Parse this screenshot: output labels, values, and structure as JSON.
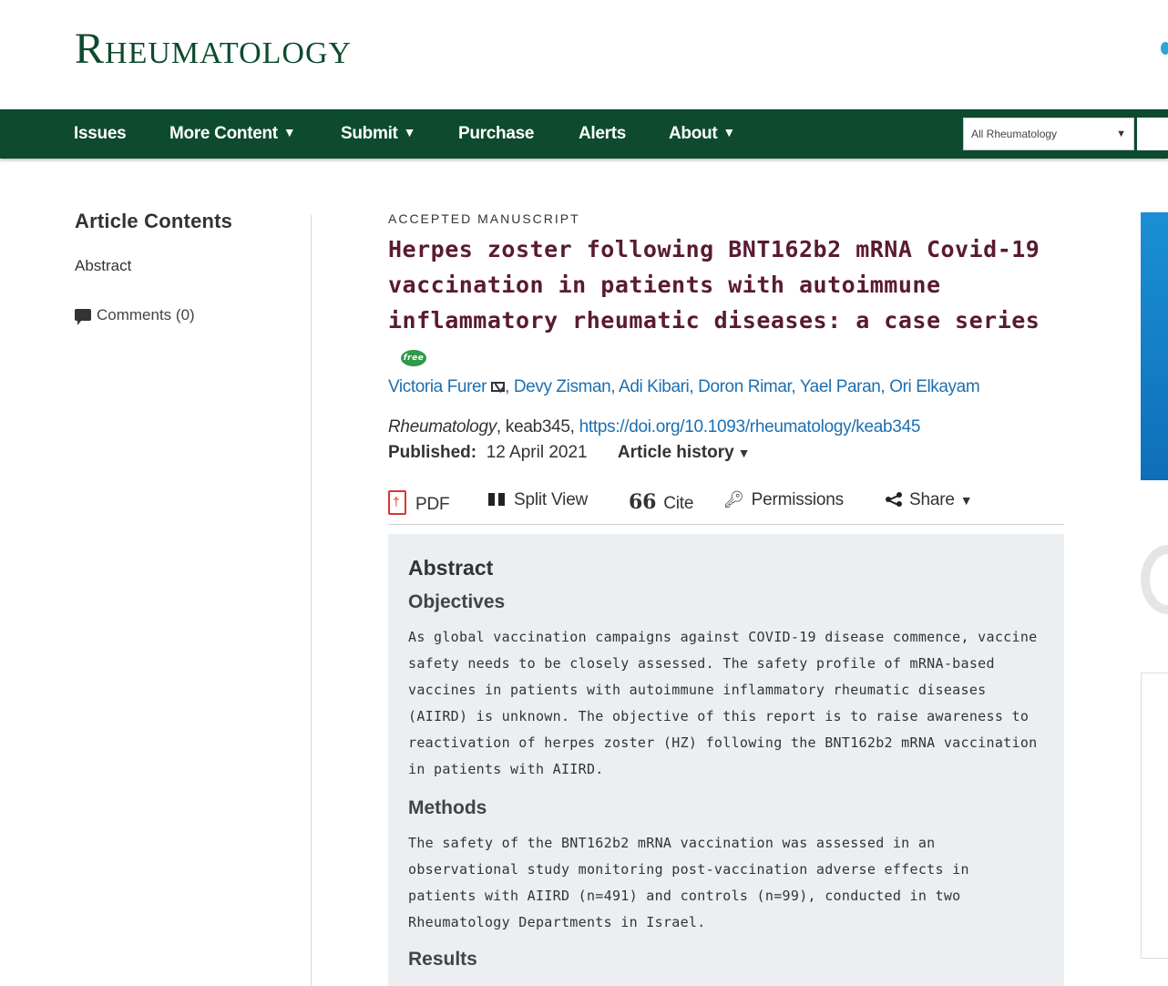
{
  "site": {
    "logo": "Rheumatology"
  },
  "nav": {
    "items": [
      {
        "label": "Issues",
        "has_menu": false
      },
      {
        "label": "More Content",
        "has_menu": true
      },
      {
        "label": "Submit",
        "has_menu": true
      },
      {
        "label": "Purchase",
        "has_menu": false
      },
      {
        "label": "Alerts",
        "has_menu": false
      },
      {
        "label": "About",
        "has_menu": true
      }
    ],
    "caret": "▼",
    "search_scope": "All Rheumatology",
    "search_caret": "▼"
  },
  "sidebar": {
    "title": "Article Contents",
    "abstract_link": "Abstract",
    "comments_link": "Comments (0)"
  },
  "article": {
    "label": "ACCEPTED MANUSCRIPT",
    "title": "Herpes zoster following BNT162b2 mRNA Covid-19 vaccination in patients with autoimmune inflammatory rheumatic diseases: a case series",
    "free_badge": "free",
    "authors": [
      "Victoria Furer",
      "Devy Zisman",
      "Adi Kibari",
      "Doron Rimar",
      "Yael Paran",
      "Ori Elkayam"
    ],
    "journal": "Rheumatology",
    "article_id": ", keab345, ",
    "doi": "https://doi.org/10.1093/rheumatology/keab345",
    "published_label": "Published:",
    "published_date": "12 April 2021",
    "history_label": "Article history",
    "caret": "▼"
  },
  "toolbar": {
    "pdf": "PDF",
    "split_view": "Split View",
    "cite": "Cite",
    "cite_glyph": "66",
    "permissions": "Permissions",
    "share": "Share",
    "caret": "▼"
  },
  "abstract": {
    "title": "Abstract",
    "objectives_heading": "Objectives",
    "objectives_text": "As global vaccination campaigns against COVID-19 disease commence, vaccine safety needs to be closely assessed. The safety profile of mRNA-based vaccines in patients with autoimmune inflammatory rheumatic diseases (AIIRD) is unknown. The objective of this report is to raise awareness to reactivation of herpes zoster (HZ) following the BNT162b2 mRNA vaccination in patients with AIIRD.",
    "methods_heading": "Methods",
    "methods_text": "The safety of the BNT162b2 mRNA vaccination was assessed in an observational study monitoring post-vaccination adverse effects in patients with AIIRD (n=491) and controls (n=99), conducted in two Rheumatology Departments in Israel.",
    "results_heading": "Results"
  },
  "icons": {
    "comment": "comment-icon",
    "mail": "mail-icon",
    "pdf": "pdf-icon",
    "split": "split-view-icon",
    "cite": "quote-icon",
    "key": "key-icon",
    "share": "share-icon"
  },
  "colors": {
    "brand_green": "#0d4a2e",
    "title_maroon": "#5a1a33",
    "link_blue": "#1d6fb0",
    "abstract_bg": "#eceff2"
  }
}
